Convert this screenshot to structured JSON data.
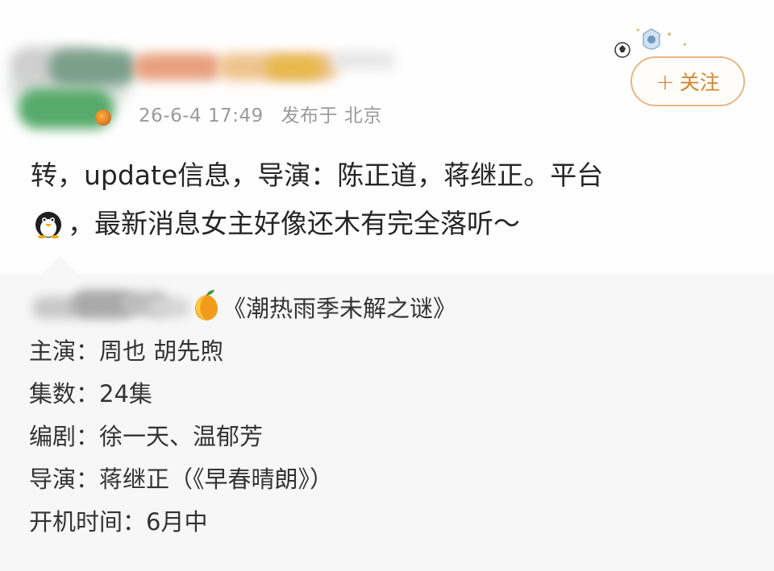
{
  "post": {
    "timestamp": "26-6-4 17:49",
    "published_from": "发布于 北京",
    "follow_label": "关注",
    "text_line1": "转，update信息，导演：陈正道，蒋继正。平台",
    "text_line2": "，最新消息女主好像还木有完全落听～"
  },
  "repost": {
    "title": "《潮热雨季未解之谜》",
    "lines": [
      "主演：周也 胡先煦",
      "集数：24集",
      "编剧：徐一天、温郁芳",
      "导演：蒋继正（《早春晴朗》）",
      "开机时间：6月中"
    ]
  },
  "icons": {
    "follow": "plus-icon",
    "platform": "penguin-icon",
    "repost_user": "mango-icon",
    "badge": "football-badge-icon"
  },
  "colors": {
    "accent": "#d6852e",
    "follow_border": "#e7b684",
    "timestamp": "#9a9a9a",
    "repost_bg": "#f7f7f7"
  }
}
